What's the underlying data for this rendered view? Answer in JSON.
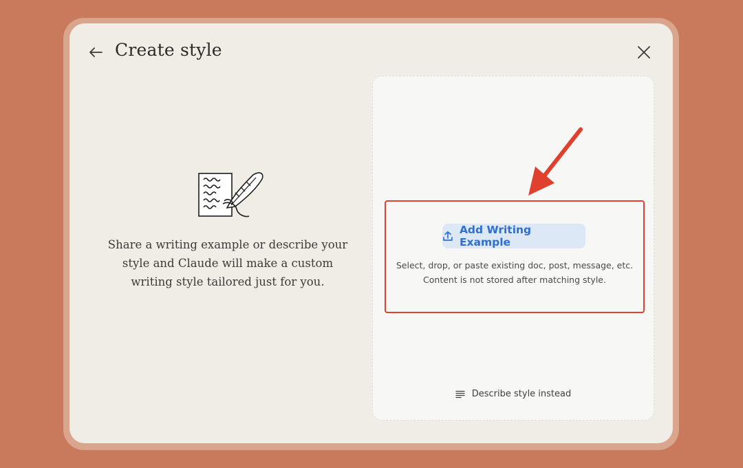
{
  "dialog": {
    "title": "Create style",
    "back_icon": "arrow-left-icon",
    "close_icon": "close-icon"
  },
  "intro": {
    "illustration": "quill-writing-illustration",
    "text_line1": "Share a writing example or describe your",
    "text_line2": "style and Claude will make a custom",
    "text_line3": "writing style tailored just for you."
  },
  "upload": {
    "button_label": "Add Writing Example",
    "button_icon": "upload-icon",
    "help_line1": "Select, drop, or paste existing doc, post, message, etc.",
    "help_line2": "Content is not stored after matching style."
  },
  "describe": {
    "label": "Describe style instead",
    "icon": "text-lines-icon"
  },
  "colors": {
    "background": "#c97a5c",
    "dialog": "#efede6",
    "accent_blue": "#2f6fd0",
    "annotation_red": "#e0402e"
  }
}
